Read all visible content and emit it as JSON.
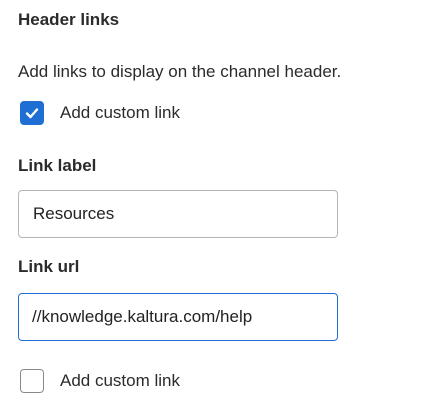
{
  "header_links": {
    "title": "Header links",
    "description": "Add links to display on the channel header."
  },
  "link1": {
    "checkbox_label": "Add custom link",
    "checked": true,
    "label_title": "Link label",
    "label_value": "Resources",
    "url_title": "Link url",
    "url_value": "//knowledge.kaltura.com/help"
  },
  "link2": {
    "checkbox_label": "Add custom link",
    "checked": false
  },
  "colors": {
    "accent": "#1f6ed4",
    "text": "#2b2b2b",
    "input_border": "#b5b5b5"
  },
  "icons": {
    "checked": "checkmark-icon"
  }
}
